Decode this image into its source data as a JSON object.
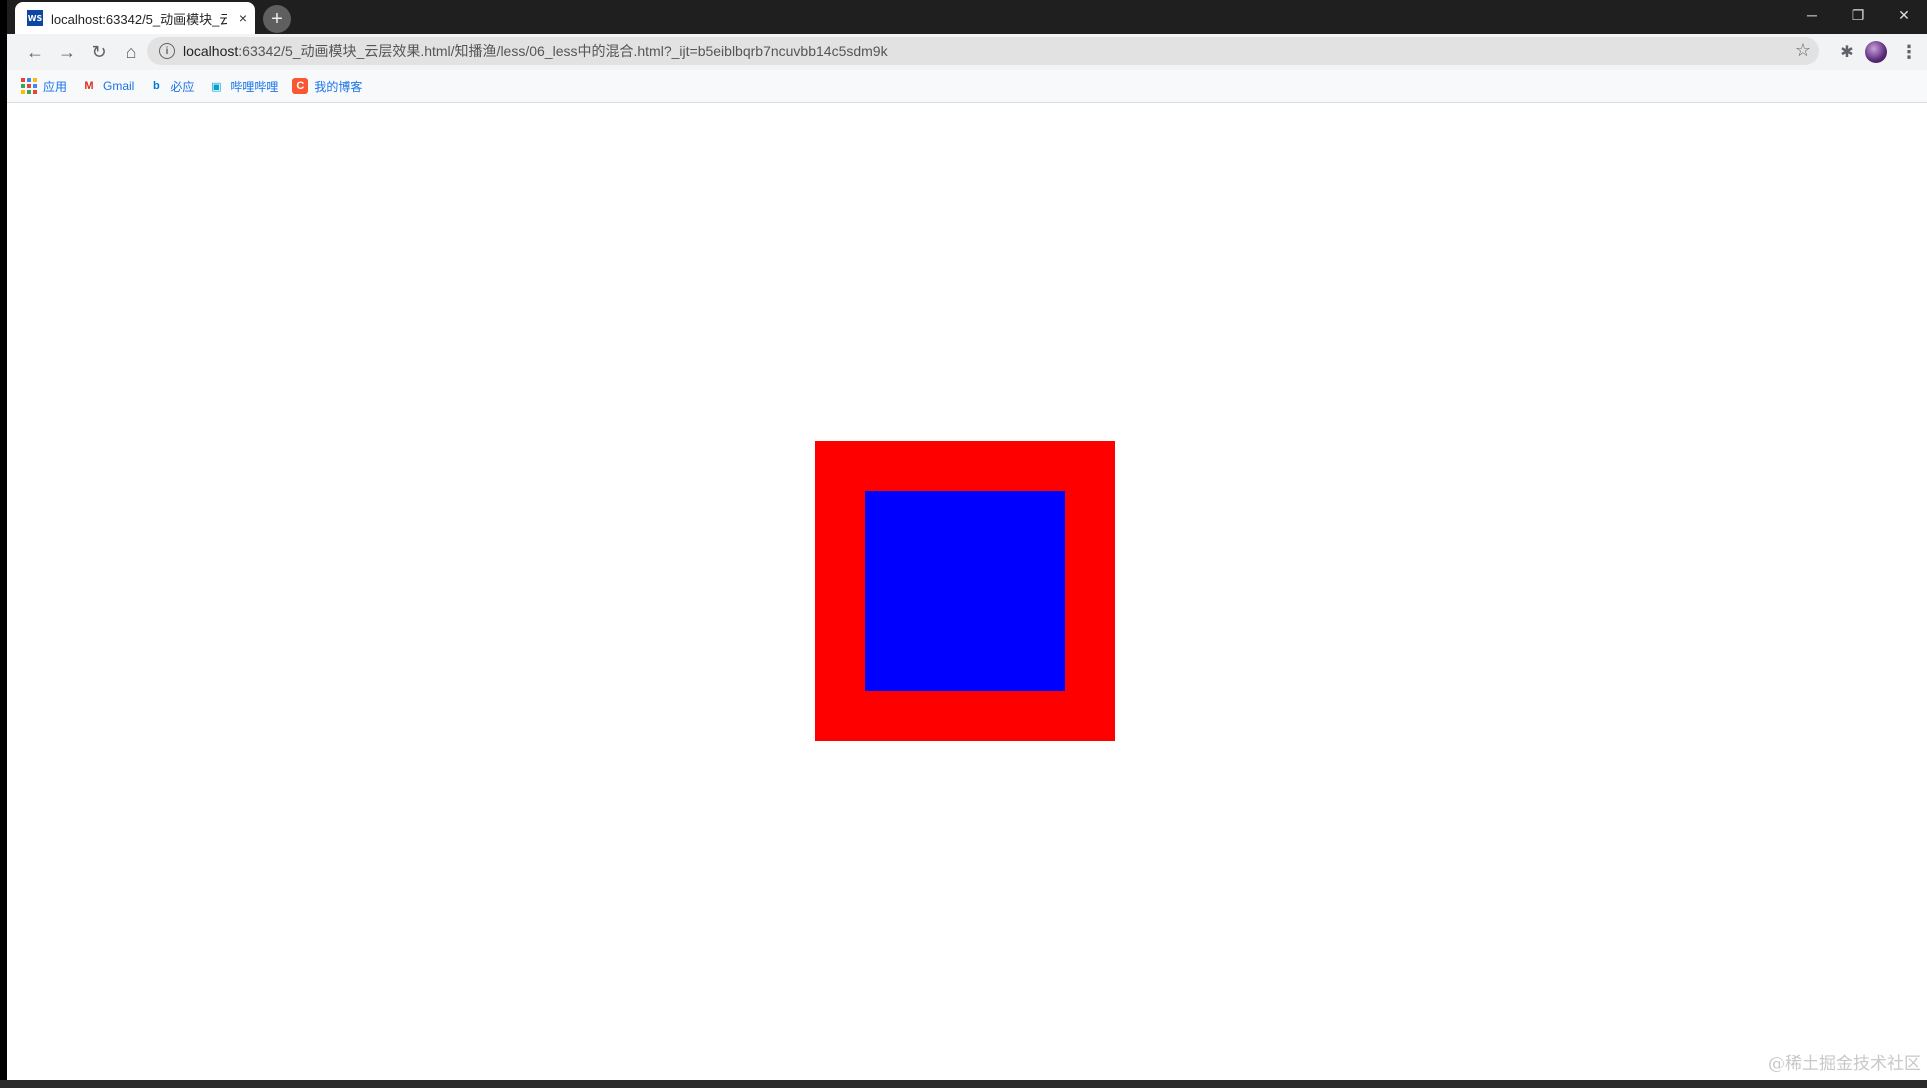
{
  "tab": {
    "favicon_text": "WS",
    "title": "localhost:63342/5_动画模块_云",
    "close_glyph": "×"
  },
  "new_tab_glyph": "+",
  "window_controls": {
    "minimize": "─",
    "restore": "❐",
    "close": "✕"
  },
  "toolbar": {
    "back_glyph": "←",
    "forward_glyph": "→",
    "reload_glyph": "↻",
    "home_glyph": "⌂",
    "info_glyph": "i",
    "url_host": "localhost",
    "url_rest": ":63342/5_动画模块_云层效果.html/知播渔/less/06_less中的混合.html?_ijt=b5eiblbqrb7ncuvbb14c5sdm9k",
    "star_glyph": "☆",
    "extensions_glyph": "✱",
    "menu_glyph": "⋮"
  },
  "bookmarks": [
    {
      "label": "应用",
      "icon": "apps-grid-icon"
    },
    {
      "label": "Gmail",
      "icon": "gmail-icon",
      "glyph": "M",
      "color": "#d93025"
    },
    {
      "label": "必应",
      "icon": "bing-icon",
      "glyph": "b",
      "color": "#0078d4"
    },
    {
      "label": "哔哩哔哩",
      "icon": "bilibili-icon",
      "glyph": "▣",
      "color": "#00a1d6"
    },
    {
      "label": "我的博客",
      "icon": "csdn-icon",
      "glyph": "C",
      "color": "#fc5531"
    }
  ],
  "page": {
    "outer_color": "#ff0000",
    "inner_color": "#0000ff"
  },
  "watermark": "@稀土掘金技术社区"
}
